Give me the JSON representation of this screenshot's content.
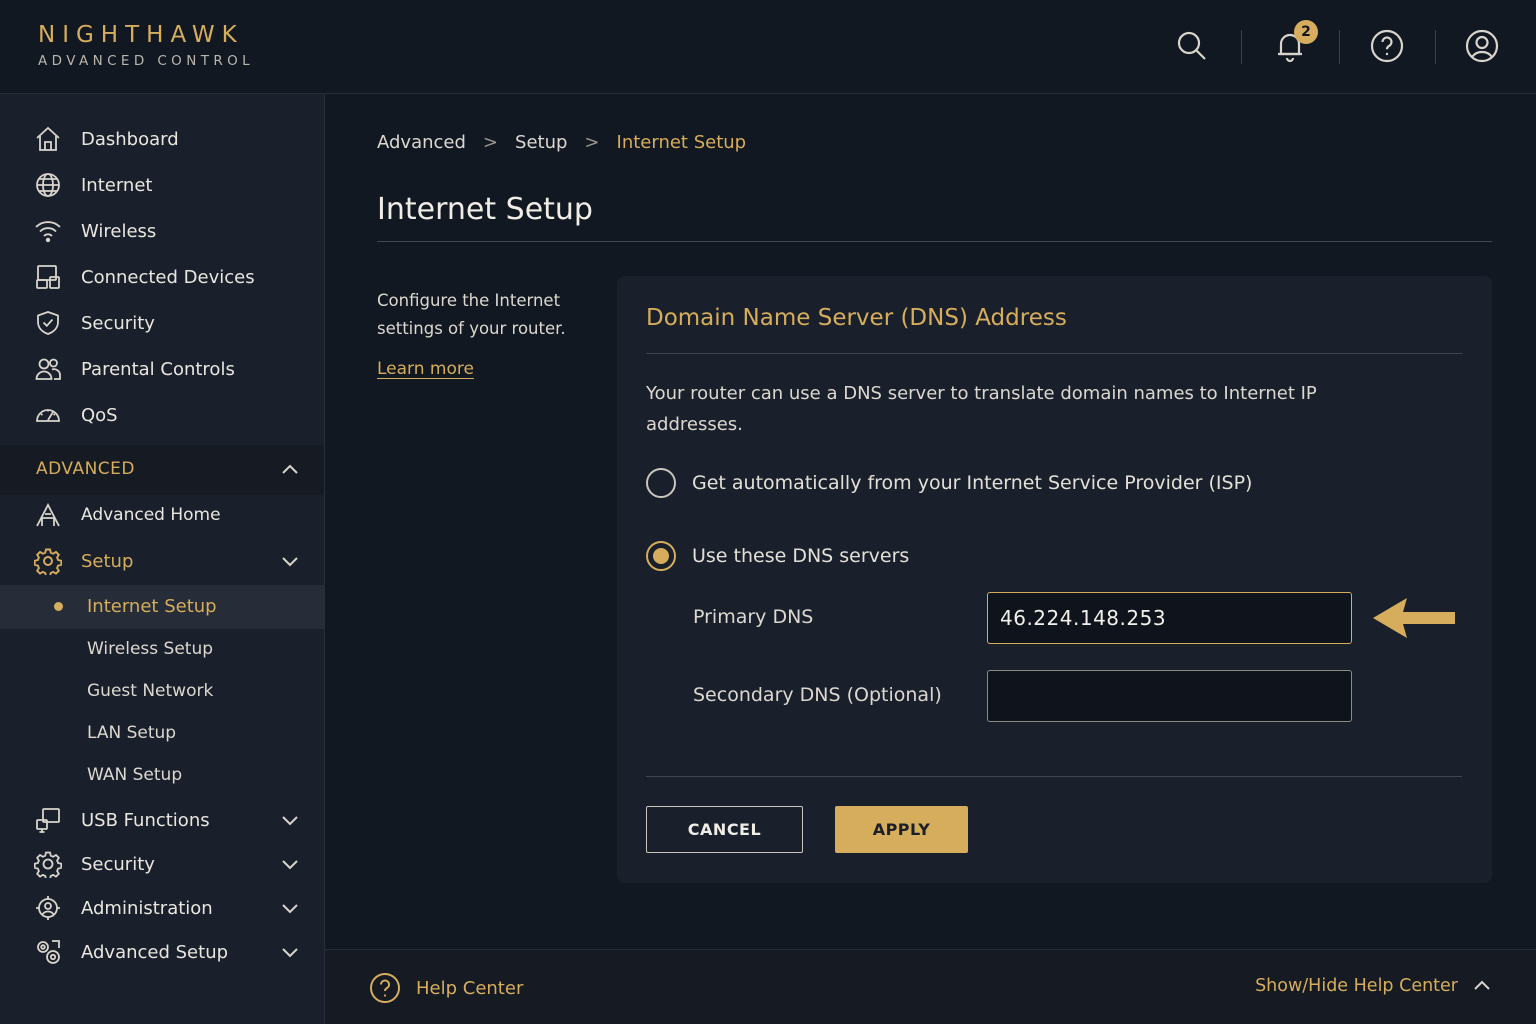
{
  "brand": {
    "name": "NIGHTHAWK",
    "subtitle": "ADVANCED CONTROL"
  },
  "header": {
    "icons": [
      "search-icon",
      "bell-icon",
      "help-icon",
      "user-icon"
    ],
    "notification_count": "2"
  },
  "sidebar": {
    "items": [
      {
        "label": "Dashboard",
        "icon": "home-icon"
      },
      {
        "label": "Internet",
        "icon": "globe-icon"
      },
      {
        "label": "Wireless",
        "icon": "wifi-icon"
      },
      {
        "label": "Connected Devices",
        "icon": "devices-icon"
      },
      {
        "label": "Security",
        "icon": "shield-icon"
      },
      {
        "label": "Parental Controls",
        "icon": "users-icon"
      },
      {
        "label": "QoS",
        "icon": "gauge-icon"
      }
    ],
    "advanced_label": "ADVANCED",
    "advanced_items": [
      {
        "label": "Advanced Home",
        "icon": "advanced-home-icon"
      },
      {
        "label": "Setup",
        "icon": "gear-icon"
      }
    ],
    "setup_subitems": [
      {
        "label": "Internet Setup",
        "active": true
      },
      {
        "label": "Wireless Setup"
      },
      {
        "label": "Guest Network"
      },
      {
        "label": "LAN Setup"
      },
      {
        "label": "WAN Setup"
      }
    ],
    "more_items": [
      {
        "label": "USB Functions",
        "icon": "usb-icon"
      },
      {
        "label": "Security",
        "icon": "security-gear-icon"
      },
      {
        "label": "Administration",
        "icon": "admin-icon"
      },
      {
        "label": "Advanced Setup",
        "icon": "advanced-setup-icon"
      }
    ]
  },
  "breadcrumb": {
    "items": [
      "Advanced",
      "Setup",
      "Internet Setup"
    ],
    "separator": ">"
  },
  "page": {
    "title": "Internet Setup",
    "intro": "Configure the Internet settings of your router.",
    "learn_more": "Learn more"
  },
  "dns": {
    "title": "Domain Name Server (DNS) Address",
    "description": "Your router can use a DNS server to translate domain names to Internet IP addresses.",
    "option_auto": "Get automatically from your Internet Service Provider (ISP)",
    "option_manual": "Use these DNS servers",
    "selected": "manual",
    "primary_label": "Primary DNS",
    "primary_value": "46.224.148.253",
    "secondary_label": "Secondary DNS (Optional)",
    "secondary_value": ""
  },
  "actions": {
    "cancel": "CANCEL",
    "apply": "APPLY"
  },
  "footer": {
    "help_center": "Help Center",
    "toggle": "Show/Hide Help Center"
  },
  "colors": {
    "accent": "#d6ad5c",
    "background": "#121822",
    "panel": "#1a202b"
  }
}
